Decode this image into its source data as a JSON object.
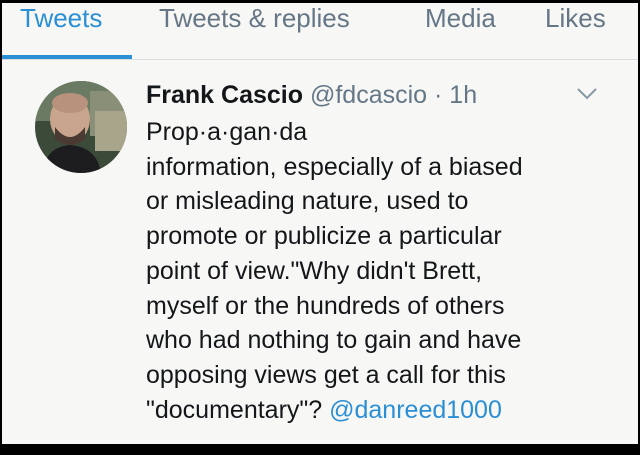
{
  "tabs": [
    {
      "label": "Tweets",
      "active": true
    },
    {
      "label": "Tweets & replies",
      "active": false
    },
    {
      "label": "Media",
      "active": false
    },
    {
      "label": "Likes",
      "active": false
    }
  ],
  "tweet": {
    "author_name": "Frank Cascio",
    "handle": "@fdcascio",
    "separator": "·",
    "time": "1h",
    "lines": [
      "Prop·a·gan·da",
      "information, especially of a biased",
      "or misleading nature, used to",
      "promote or publicize a particular",
      "point of view.\"Why didn't Brett,",
      "myself or the hundreds of others",
      "who had nothing to gain and have",
      "opposing views get a call for this"
    ],
    "last_line_text": "\"documentary\"? ",
    "mention": "@danreed1000"
  },
  "icons": {
    "avatar": "profile-photo",
    "menu": "chevron-down-icon"
  },
  "colors": {
    "accent": "#2b8fd6",
    "muted": "#657786",
    "text": "#14171a",
    "background": "#f7f7f5"
  }
}
